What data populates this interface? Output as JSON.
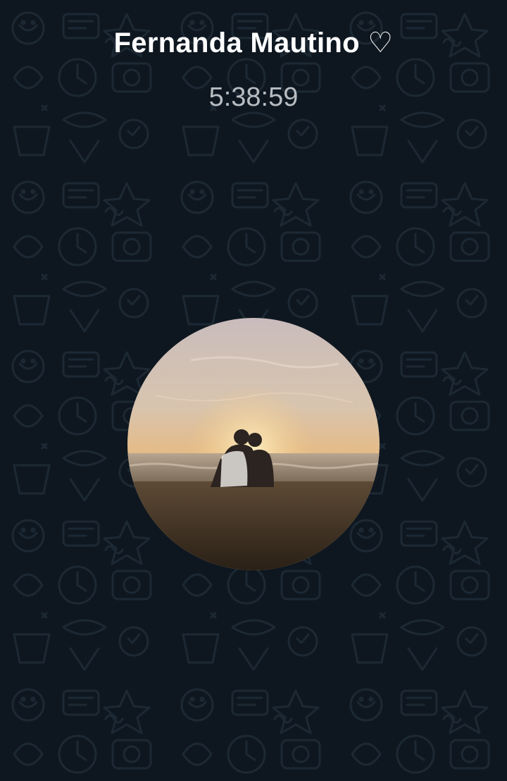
{
  "call": {
    "contact_name": "Fernanda Mautino ♡",
    "duration": "5:38:59"
  },
  "icons": {
    "wallpaper": "doodle-pattern-background",
    "avatar": "profile-photo-sunset-couple-beach"
  },
  "colors": {
    "background": "#0e1720",
    "doodle_stroke": "#1c2833",
    "name_text": "#ffffff",
    "timer_text": "#b8bdc2"
  }
}
